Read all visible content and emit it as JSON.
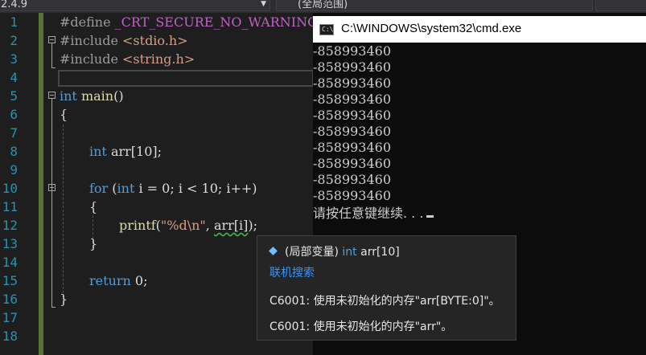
{
  "toolbar": {
    "left_combo": "2.4.9",
    "right_combo": "(全局范围)"
  },
  "editor": {
    "line_numbers": [
      "1",
      "2",
      "3",
      "4",
      "5",
      "6",
      "7",
      "8",
      "9",
      "10",
      "11",
      "12",
      "13",
      "14",
      "15",
      "16",
      "17",
      "18"
    ],
    "lines": {
      "l1_pp": "#define",
      "l1_macro": "_CRT_SECURE_NO_WARNINGS",
      "l2_pp": "#include",
      "l2_hdr": "<stdio.h>",
      "l3_pp": "#include",
      "l3_hdr": "<string.h>",
      "l5_kw": "int",
      "l5_fn": "main",
      "l5_rest": "()",
      "l6": "{",
      "l8_kw": "int",
      "l8_var": "arr",
      "l8_rest": "[10];",
      "l10_kw": "for",
      "l10_a": " (",
      "l10_kw2": "int",
      "l10_b": " i = 0; i < 10; i++)",
      "l11": "{",
      "l12_fn": "printf",
      "l12_a": "(",
      "l12_str": "\"%d\\n\"",
      "l12_b": ", ",
      "l12_arr": "arr[i]",
      "l12_c": ");",
      "l13": "}",
      "l15_kw": "return",
      "l15_rest": " 0;",
      "l16": "}"
    }
  },
  "console": {
    "title": "C:\\WINDOWS\\system32\\cmd.exe",
    "output": [
      "-858993460",
      "-858993460",
      "-858993460",
      "-858993460",
      "-858993460",
      "-858993460",
      "-858993460",
      "-858993460",
      "-858993460",
      "-858993460"
    ],
    "prompt": "请按任意键继续. . ."
  },
  "tooltip": {
    "scope": "(局部变量)",
    "type_kw": "int",
    "name": "arr[10]",
    "search_link": "联机搜索",
    "warning1": "C6001: 使用未初始化的内存\"arr[BYTE:0]\"。",
    "warning2": "C6001: 使用未初始化的内存\"arr\"。"
  },
  "colors": {
    "editor_bg": "#1e1e1e",
    "keyword": "#569cd6",
    "line_number": "#2b91af",
    "change_bar": "#57733a",
    "console_bg": "#0c0c0c",
    "link": "#3794ff"
  }
}
